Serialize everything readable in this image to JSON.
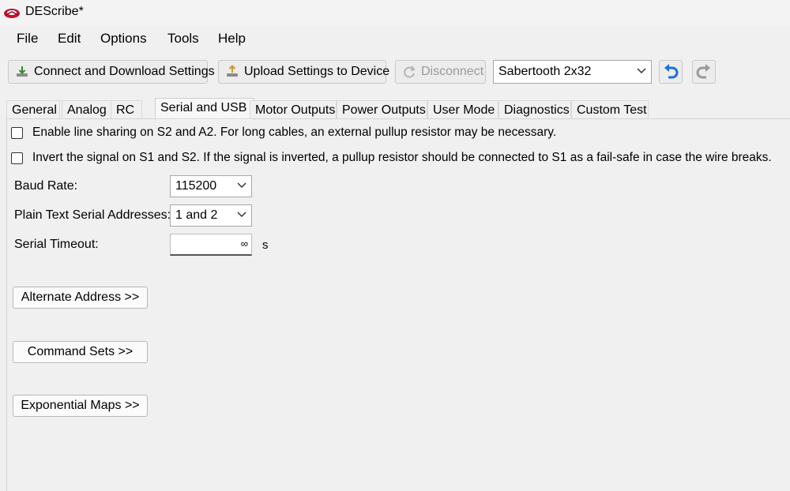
{
  "window": {
    "title": "DEScribe*"
  },
  "menu": [
    "File",
    "Edit",
    "Options",
    "Tools",
    "Help"
  ],
  "toolbar": {
    "connect_label": "Connect and Download Settings",
    "upload_label": "Upload Settings to Device",
    "disconnect_label": "Disconnect",
    "device_selected": "Sabertooth 2x32"
  },
  "tabs": [
    "General",
    "Analog",
    "RC",
    "Serial and USB",
    "Motor Outputs",
    "Power Outputs",
    "User Mode",
    "Diagnostics",
    "Custom Test"
  ],
  "active_tab": "Serial and USB",
  "serial": {
    "line_sharing_label": "Enable line sharing on S2 and A2. For long cables, an external pullup resistor may be necessary.",
    "line_sharing_checked": false,
    "invert_label": "Invert the signal on S1 and S2. If the signal is inverted, a pullup resistor should be connected to S1 as a fail-safe in case the wire breaks.",
    "invert_checked": false,
    "baud_label": "Baud Rate:",
    "baud_value": "115200",
    "addresses_label": "Plain Text Serial Addresses:",
    "addresses_value": "1 and 2",
    "timeout_label": "Serial Timeout:",
    "timeout_value": "∞",
    "timeout_unit": "s"
  },
  "buttons": {
    "alternate_address": "Alternate Address >>",
    "command_sets": "Command Sets >>",
    "exponential_maps": "Exponential Maps >>"
  },
  "colors": {
    "logo_red": "#c8102e",
    "undo_blue": "#1e6fd9"
  }
}
